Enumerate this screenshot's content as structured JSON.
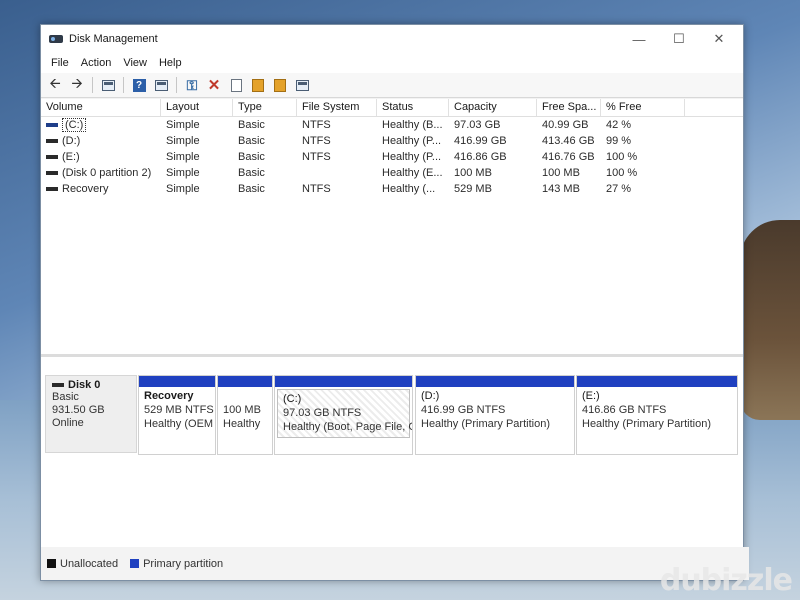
{
  "window": {
    "title": "Disk Management",
    "minimize_glyph": "—",
    "maximize_glyph": "☐",
    "close_glyph": "✕"
  },
  "menu": [
    "File",
    "Action",
    "View",
    "Help"
  ],
  "toolbar": {
    "icons": [
      "back-arrow-icon",
      "forward-arrow-icon",
      "console-tree-icon",
      "help-icon",
      "properties-icon",
      "connect-disk-icon",
      "delete-icon",
      "check-icon",
      "import-icon",
      "refresh-icon",
      "list-icon"
    ]
  },
  "volume_list": {
    "columns": [
      "Volume",
      "Layout",
      "Type",
      "File System",
      "Status",
      "Capacity",
      "Free Spa...",
      "% Free"
    ],
    "rows": [
      {
        "volume": "(C:)",
        "layout": "Simple",
        "type": "Basic",
        "fs": "NTFS",
        "status": "Healthy (B...",
        "capacity": "97.03 GB",
        "free": "40.99 GB",
        "pct": "42 %"
      },
      {
        "volume": "(D:)",
        "layout": "Simple",
        "type": "Basic",
        "fs": "NTFS",
        "status": "Healthy (P...",
        "capacity": "416.99 GB",
        "free": "413.46 GB",
        "pct": "99 %"
      },
      {
        "volume": "(E:)",
        "layout": "Simple",
        "type": "Basic",
        "fs": "NTFS",
        "status": "Healthy (P...",
        "capacity": "416.86 GB",
        "free": "416.76 GB",
        "pct": "100 %"
      },
      {
        "volume": "(Disk 0 partition 2)",
        "layout": "Simple",
        "type": "Basic",
        "fs": "",
        "status": "Healthy (E...",
        "capacity": "100 MB",
        "free": "100 MB",
        "pct": "100 %"
      },
      {
        "volume": "Recovery",
        "layout": "Simple",
        "type": "Basic",
        "fs": "NTFS",
        "status": "Healthy (...",
        "capacity": "529 MB",
        "free": "143 MB",
        "pct": "27 %"
      }
    ]
  },
  "disk": {
    "name": "Disk 0",
    "type": "Basic",
    "size": "931.50 GB",
    "state": "Online",
    "partitions": [
      {
        "name": "Recovery",
        "size": "529 MB NTFS",
        "status": "Healthy (OEM"
      },
      {
        "name": "",
        "size": "100 MB",
        "status": "Healthy"
      },
      {
        "name": "(C:)",
        "size": "97.03 GB NTFS",
        "status": "Healthy (Boot, Page File, C"
      },
      {
        "name": "(D:)",
        "size": "416.99 GB NTFS",
        "status": "Healthy (Primary Partition)"
      },
      {
        "name": "(E:)",
        "size": "416.86 GB NTFS",
        "status": "Healthy (Primary Partition)"
      }
    ]
  },
  "legend": {
    "unallocated": {
      "label": "Unallocated",
      "color": "#111111"
    },
    "primary": {
      "label": "Primary partition",
      "color": "#1f40c0"
    }
  },
  "watermark": "dubizzle"
}
